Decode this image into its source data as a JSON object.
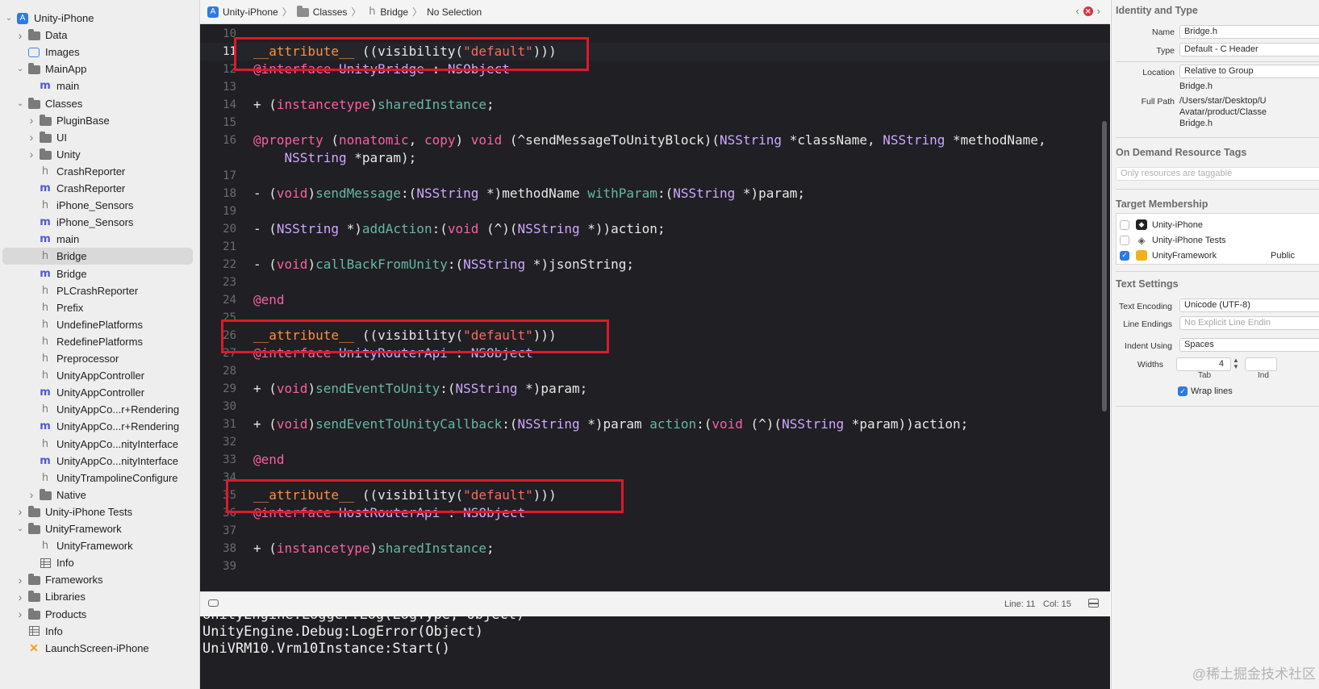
{
  "navigator": {
    "items": [
      {
        "label": "Unity-iPhone",
        "icon": "project-icon",
        "disc": "open"
      },
      {
        "label": "Data",
        "icon": "folder-icon",
        "disc": "closed"
      },
      {
        "label": "Images",
        "icon": "images-icon",
        "disc": ""
      },
      {
        "label": "MainApp",
        "icon": "folder-icon",
        "disc": "open"
      },
      {
        "label": "main",
        "icon": "objc-file-icon",
        "disc": ""
      },
      {
        "label": "Classes",
        "icon": "folder-icon",
        "disc": "open"
      },
      {
        "label": "PluginBase",
        "icon": "folder-icon",
        "disc": "closed"
      },
      {
        "label": "UI",
        "icon": "folder-icon",
        "disc": "closed"
      },
      {
        "label": "Unity",
        "icon": "folder-icon",
        "disc": "closed"
      },
      {
        "label": "CrashReporter",
        "icon": "header-file-icon",
        "disc": ""
      },
      {
        "label": "CrashReporter",
        "icon": "objc-file-icon",
        "disc": ""
      },
      {
        "label": "iPhone_Sensors",
        "icon": "header-file-icon",
        "disc": ""
      },
      {
        "label": "iPhone_Sensors",
        "icon": "objc-file-icon",
        "disc": ""
      },
      {
        "label": "main",
        "icon": "objc-file-icon",
        "disc": ""
      },
      {
        "label": "Bridge",
        "icon": "header-file-icon",
        "disc": "",
        "selected": true
      },
      {
        "label": "Bridge",
        "icon": "objc-file-icon",
        "disc": ""
      },
      {
        "label": "PLCrashReporter",
        "icon": "header-file-icon",
        "disc": ""
      },
      {
        "label": "Prefix",
        "icon": "header-file-icon",
        "disc": ""
      },
      {
        "label": "UndefinePlatforms",
        "icon": "header-file-icon",
        "disc": ""
      },
      {
        "label": "RedefinePlatforms",
        "icon": "header-file-icon",
        "disc": ""
      },
      {
        "label": "Preprocessor",
        "icon": "header-file-icon",
        "disc": ""
      },
      {
        "label": "UnityAppController",
        "icon": "header-file-icon",
        "disc": ""
      },
      {
        "label": "UnityAppController",
        "icon": "objc-file-icon",
        "disc": ""
      },
      {
        "label": "UnityAppCo...r+Rendering",
        "icon": "header-file-icon",
        "disc": ""
      },
      {
        "label": "UnityAppCo...r+Rendering",
        "icon": "objc-file-icon",
        "disc": ""
      },
      {
        "label": "UnityAppCo...nityInterface",
        "icon": "header-file-icon",
        "disc": ""
      },
      {
        "label": "UnityAppCo...nityInterface",
        "icon": "objc-file-icon",
        "disc": ""
      },
      {
        "label": "UnityTrampolineConfigure",
        "icon": "header-file-icon",
        "disc": ""
      },
      {
        "label": "Native",
        "icon": "folder-icon",
        "disc": "closed"
      },
      {
        "label": "Unity-iPhone Tests",
        "icon": "folder-icon",
        "disc": "closed"
      },
      {
        "label": "UnityFramework",
        "icon": "folder-icon",
        "disc": "open"
      },
      {
        "label": "UnityFramework",
        "icon": "header-file-icon",
        "disc": ""
      },
      {
        "label": "Info",
        "icon": "plist-icon",
        "disc": ""
      },
      {
        "label": "Frameworks",
        "icon": "folder-icon",
        "disc": "closed"
      },
      {
        "label": "Libraries",
        "icon": "folder-icon",
        "disc": "closed"
      },
      {
        "label": "Products",
        "icon": "folder-icon",
        "disc": "closed"
      },
      {
        "label": "Info",
        "icon": "plist-icon",
        "disc": ""
      },
      {
        "label": "LaunchScreen-iPhone",
        "icon": "launchscreen-icon",
        "disc": ""
      }
    ]
  },
  "jumpbar": {
    "crumbs": [
      "Unity-iPhone",
      "Classes",
      "Bridge",
      "No Selection"
    ]
  },
  "editor": {
    "lines": [
      {
        "n": "10",
        "tokens": []
      },
      {
        "n": "11",
        "current": true,
        "tokens": [
          {
            "c": "at",
            "t": "__attribute__"
          },
          {
            "c": "df",
            "t": " ((visibility("
          },
          {
            "c": "st",
            "t": "\"default\""
          },
          {
            "c": "df",
            "t": ")))"
          }
        ]
      },
      {
        "n": "12",
        "tokens": [
          {
            "c": "kw",
            "t": "@interface"
          },
          {
            "c": "df",
            "t": " "
          },
          {
            "c": "ty",
            "t": "UnityBridge"
          },
          {
            "c": "df",
            "t": " : "
          },
          {
            "c": "ty",
            "t": "NSObject"
          }
        ]
      },
      {
        "n": "13",
        "tokens": []
      },
      {
        "n": "14",
        "tokens": [
          {
            "c": "df",
            "t": "+ ("
          },
          {
            "c": "kw",
            "t": "instancetype"
          },
          {
            "c": "df",
            "t": ")"
          },
          {
            "c": "fn",
            "t": "sharedInstance"
          },
          {
            "c": "df",
            "t": ";"
          }
        ]
      },
      {
        "n": "15",
        "tokens": []
      },
      {
        "n": "16",
        "tokens": [
          {
            "c": "kw",
            "t": "@property"
          },
          {
            "c": "df",
            "t": " ("
          },
          {
            "c": "kw",
            "t": "nonatomic"
          },
          {
            "c": "df",
            "t": ", "
          },
          {
            "c": "kw",
            "t": "copy"
          },
          {
            "c": "df",
            "t": ") "
          },
          {
            "c": "kw",
            "t": "void"
          },
          {
            "c": "df",
            "t": " (^sendMessageToUnityBlock)("
          },
          {
            "c": "ty",
            "t": "NSString"
          },
          {
            "c": "df",
            "t": " *className, "
          },
          {
            "c": "ty",
            "t": "NSString"
          },
          {
            "c": "df",
            "t": " *methodName,"
          }
        ]
      },
      {
        "n": "",
        "tokens": [
          {
            "c": "df",
            "t": "    "
          },
          {
            "c": "ty",
            "t": "NSString"
          },
          {
            "c": "df",
            "t": " *param);"
          }
        ]
      },
      {
        "n": "17",
        "tokens": []
      },
      {
        "n": "18",
        "tokens": [
          {
            "c": "df",
            "t": "- ("
          },
          {
            "c": "kw",
            "t": "void"
          },
          {
            "c": "df",
            "t": ")"
          },
          {
            "c": "fn",
            "t": "sendMessage"
          },
          {
            "c": "df",
            "t": ":("
          },
          {
            "c": "ty",
            "t": "NSString"
          },
          {
            "c": "df",
            "t": " *)methodName "
          },
          {
            "c": "fn",
            "t": "withParam"
          },
          {
            "c": "df",
            "t": ":("
          },
          {
            "c": "ty",
            "t": "NSString"
          },
          {
            "c": "df",
            "t": " *)param;"
          }
        ]
      },
      {
        "n": "19",
        "tokens": []
      },
      {
        "n": "20",
        "tokens": [
          {
            "c": "df",
            "t": "- ("
          },
          {
            "c": "ty",
            "t": "NSString"
          },
          {
            "c": "df",
            "t": " *)"
          },
          {
            "c": "fn",
            "t": "addAction"
          },
          {
            "c": "df",
            "t": ":("
          },
          {
            "c": "kw",
            "t": "void"
          },
          {
            "c": "df",
            "t": " (^)("
          },
          {
            "c": "ty",
            "t": "NSString"
          },
          {
            "c": "df",
            "t": " *))action;"
          }
        ]
      },
      {
        "n": "21",
        "tokens": []
      },
      {
        "n": "22",
        "tokens": [
          {
            "c": "df",
            "t": "- ("
          },
          {
            "c": "kw",
            "t": "void"
          },
          {
            "c": "df",
            "t": ")"
          },
          {
            "c": "fn",
            "t": "callBackFromUnity"
          },
          {
            "c": "df",
            "t": ":("
          },
          {
            "c": "ty",
            "t": "NSString"
          },
          {
            "c": "df",
            "t": " *)jsonString;"
          }
        ]
      },
      {
        "n": "23",
        "tokens": []
      },
      {
        "n": "24",
        "tokens": [
          {
            "c": "kw",
            "t": "@end"
          }
        ]
      },
      {
        "n": "25",
        "tokens": []
      },
      {
        "n": "26",
        "tokens": [
          {
            "c": "at",
            "t": "__attribute__"
          },
          {
            "c": "df",
            "t": " ((visibility("
          },
          {
            "c": "st",
            "t": "\"default\""
          },
          {
            "c": "df",
            "t": ")))"
          }
        ]
      },
      {
        "n": "27",
        "tokens": [
          {
            "c": "kw",
            "t": "@interface"
          },
          {
            "c": "df",
            "t": " "
          },
          {
            "c": "ty",
            "t": "UnityRouterApi"
          },
          {
            "c": "df",
            "t": " : "
          },
          {
            "c": "ty",
            "t": "NSObject"
          }
        ]
      },
      {
        "n": "28",
        "tokens": []
      },
      {
        "n": "29",
        "tokens": [
          {
            "c": "df",
            "t": "+ ("
          },
          {
            "c": "kw",
            "t": "void"
          },
          {
            "c": "df",
            "t": ")"
          },
          {
            "c": "fn",
            "t": "sendEventToUnity"
          },
          {
            "c": "df",
            "t": ":("
          },
          {
            "c": "ty",
            "t": "NSString"
          },
          {
            "c": "df",
            "t": " *)param;"
          }
        ]
      },
      {
        "n": "30",
        "tokens": []
      },
      {
        "n": "31",
        "tokens": [
          {
            "c": "df",
            "t": "+ ("
          },
          {
            "c": "kw",
            "t": "void"
          },
          {
            "c": "df",
            "t": ")"
          },
          {
            "c": "fn",
            "t": "sendEventToUnityCallback"
          },
          {
            "c": "df",
            "t": ":("
          },
          {
            "c": "ty",
            "t": "NSString"
          },
          {
            "c": "df",
            "t": " *)param "
          },
          {
            "c": "fn",
            "t": "action"
          },
          {
            "c": "df",
            "t": ":("
          },
          {
            "c": "kw",
            "t": "void"
          },
          {
            "c": "df",
            "t": " (^)("
          },
          {
            "c": "ty",
            "t": "NSString"
          },
          {
            "c": "df",
            "t": " *param))action;"
          }
        ]
      },
      {
        "n": "32",
        "tokens": []
      },
      {
        "n": "33",
        "tokens": [
          {
            "c": "kw",
            "t": "@end"
          }
        ]
      },
      {
        "n": "34",
        "tokens": []
      },
      {
        "n": "35",
        "tokens": [
          {
            "c": "at",
            "t": "__attribute__"
          },
          {
            "c": "df",
            "t": " ((visibility("
          },
          {
            "c": "st",
            "t": "\"default\""
          },
          {
            "c": "df",
            "t": ")))"
          }
        ]
      },
      {
        "n": "36",
        "tokens": [
          {
            "c": "kw",
            "t": "@interface"
          },
          {
            "c": "df",
            "t": " "
          },
          {
            "c": "ty",
            "t": "HostRouterApi"
          },
          {
            "c": "df",
            "t": " : "
          },
          {
            "c": "ty",
            "t": "NSObject"
          }
        ]
      },
      {
        "n": "37",
        "tokens": []
      },
      {
        "n": "38",
        "tokens": [
          {
            "c": "df",
            "t": "+ ("
          },
          {
            "c": "kw",
            "t": "instancetype"
          },
          {
            "c": "df",
            "t": ")"
          },
          {
            "c": "fn",
            "t": "sharedInstance"
          },
          {
            "c": "df",
            "t": ";"
          }
        ]
      },
      {
        "n": "39",
        "tokens": []
      }
    ]
  },
  "statusbar": {
    "line": "Line: 11",
    "col": "Col: 15"
  },
  "console": {
    "lines": [
      "UnityEngine.Logger:Log(LogType, Object)",
      "UnityEngine.Debug:LogError(Object)",
      "UniVRM10.Vrm10Instance:Start()"
    ]
  },
  "inspector": {
    "identity": {
      "title": "Identity and Type",
      "name_label": "Name",
      "name_value": "Bridge.h",
      "type_label": "Type",
      "type_value": "Default - C Header",
      "location_label": "Location",
      "location_value": "Relative to Group",
      "location_file": "Bridge.h",
      "fullpath_label": "Full Path",
      "fullpath_lines": [
        "/Users/star/Desktop/U",
        "Avatar/product/Classe",
        "Bridge.h"
      ]
    },
    "odr": {
      "title": "On Demand Resource Tags",
      "placeholder": "Only resources are taggable"
    },
    "target": {
      "title": "Target Membership",
      "rows": [
        {
          "label": "Unity-iPhone",
          "checked": false,
          "icon": "app-icon",
          "extra": ""
        },
        {
          "label": "Unity-iPhone Tests",
          "checked": false,
          "icon": "test-target-icon",
          "extra": ""
        },
        {
          "label": "UnityFramework",
          "checked": true,
          "icon": "framework-icon",
          "extra": "Public"
        }
      ]
    },
    "text": {
      "title": "Text Settings",
      "encoding_label": "Text Encoding",
      "encoding_value": "Unicode (UTF-8)",
      "endings_label": "Line Endings",
      "endings_value": "No Explicit Line Endin",
      "indent_label": "Indent Using",
      "indent_value": "Spaces",
      "widths_label": "Widths",
      "tab_value": "4",
      "tab_caption": "Tab",
      "indent_caption": "Ind",
      "wrap_label": "Wrap lines"
    }
  },
  "watermark": "@稀土掘金技术社区"
}
